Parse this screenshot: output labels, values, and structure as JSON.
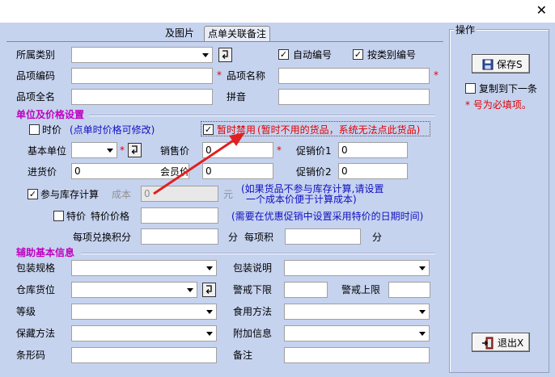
{
  "tabs": {
    "pictures": "及图片",
    "remarks": "点单关联备注"
  },
  "basic": {
    "category_label": "所属类别",
    "auto_number": "自动编号",
    "by_category_number": "按类别编号",
    "item_code_label": "品项编码",
    "item_name_label": "品项名称",
    "full_name_label": "品项全名",
    "pinyin_label": "拼音",
    "required_mark": "*"
  },
  "unit_price": {
    "section_title": "单位及价格设置",
    "seasonal_price": "时价",
    "seasonal_note": "(点单时价格可修改)",
    "disable_label": "暂时禁用",
    "disable_note": "(暂时不用的货品，系统无法点此货品)",
    "base_unit_label": "基本单位",
    "sale_price_label": "销售价",
    "sale_price_value": "0",
    "promo_price1_label": "促销价1",
    "promo_price1_value": "0",
    "purchase_price_label": "进货价",
    "purchase_price_value": "0",
    "member_price_label": "会员价",
    "member_price_value": "0",
    "promo_price2_label": "促销价2",
    "promo_price2_value": "0",
    "inventory_calc": "参与库存计算",
    "cost_label": "成本",
    "cost_value": "0",
    "yuan": "元",
    "inventory_note_line1": "(如果货品不参与库存计算,请设置",
    "inventory_note_line2": "一个成本价便于计算成本)",
    "special_price": "特价",
    "special_price_label": "特价价格",
    "special_note": "(需要在优惠促销中设置采用特价的日期时间)",
    "exchange_points_label": "每项兑换积分",
    "points_unit": "分",
    "points_label": "每项积",
    "points_unit2": "分"
  },
  "aux": {
    "section_title": "辅助基本信息",
    "pack_spec_label": "包装规格",
    "pack_desc_label": "包装说明",
    "warehouse_label": "仓库货位",
    "warn_low_label": "警戒下限",
    "warn_high_label": "警戒上限",
    "grade_label": "等级",
    "food_method_label": "食用方法",
    "storage_label": "保藏方法",
    "extra_info_label": "附加信息",
    "barcode_label": "条形码",
    "remark_label": "备注"
  },
  "ops": {
    "group_title": "操作",
    "save_button": "保存S",
    "copy_next": "复制到下一条",
    "required_hint": "* 号为必填项。",
    "exit_button": "退出X"
  },
  "colors": {
    "client_bg": "#c6d3ef",
    "section": "#c000c0",
    "note": "#1010c0",
    "required": "#e00000",
    "arrow": "#e02020"
  }
}
